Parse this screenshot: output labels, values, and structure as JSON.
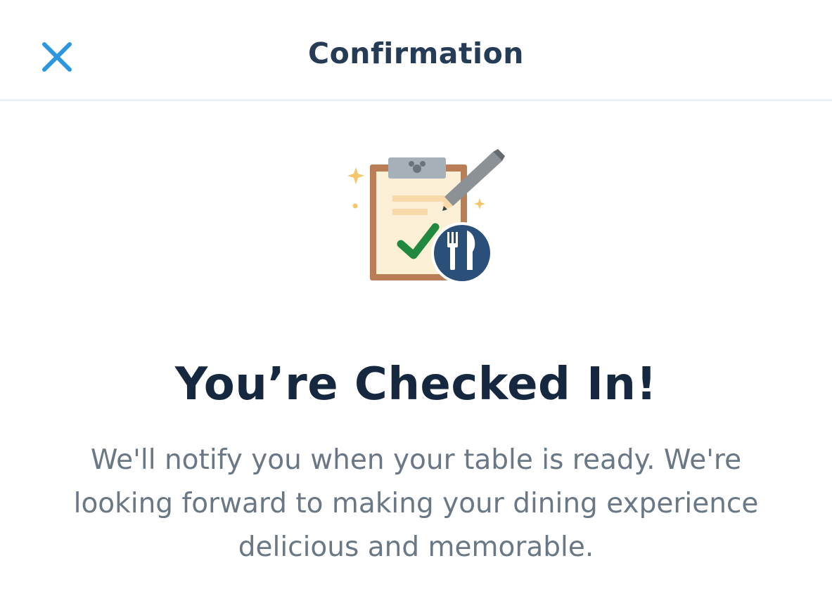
{
  "header": {
    "title": "Confirmation",
    "close_icon": "close-icon"
  },
  "illustration": {
    "icon": "clipboard-check-dining-icon",
    "colors": {
      "clipboard": "#b97e55",
      "paper": "#fbf0d5",
      "clip": "#a6b0b8",
      "check": "#21893f",
      "badge": "#2a4f79",
      "sparkle": "#f3c66b"
    }
  },
  "main": {
    "title": "You’re Checked In!",
    "message": "We'll notify you when your table is ready. We're looking forward to making your dining experience delicious and memorable."
  },
  "colors": {
    "accent": "#2c97de",
    "title": "#16283f",
    "body_text": "#6a7784",
    "divider": "#e8f0f3"
  }
}
